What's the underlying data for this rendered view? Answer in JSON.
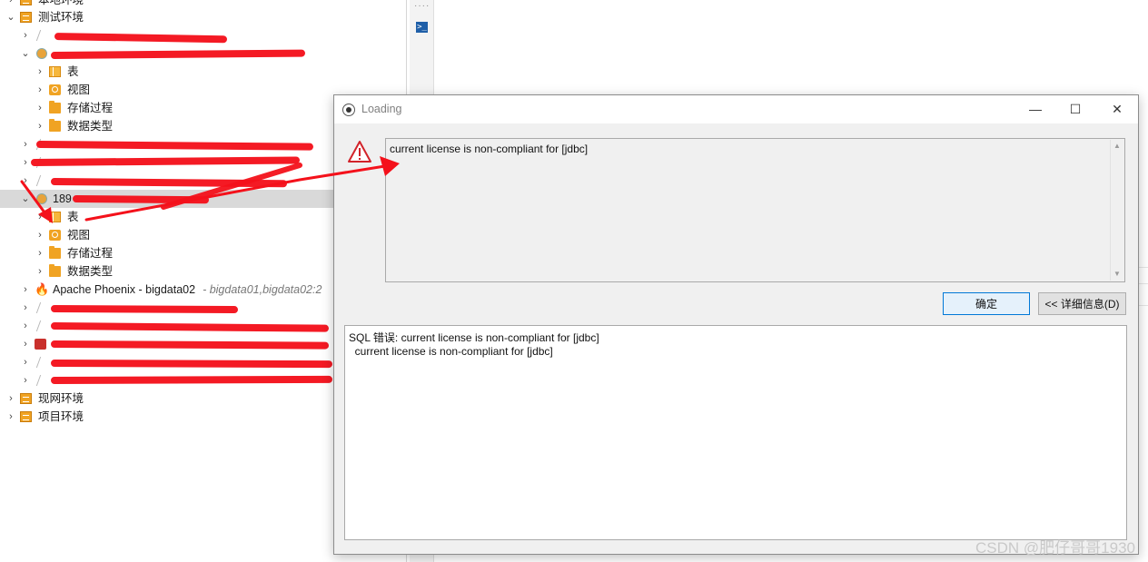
{
  "navigator": {
    "rows": [
      {
        "label": "本地环境",
        "sub": ""
      },
      {
        "label": "测试环境",
        "sub": ""
      },
      {
        "label": "",
        "sub": ""
      },
      {
        "label": "",
        "sub": ""
      },
      {
        "label": "表",
        "sub": ""
      },
      {
        "label": "视图",
        "sub": ""
      },
      {
        "label": "存储过程",
        "sub": ""
      },
      {
        "label": "数据类型",
        "sub": ""
      },
      {
        "label": "",
        "sub": ""
      },
      {
        "label": "",
        "sub": ""
      },
      {
        "label": "",
        "sub": ""
      },
      {
        "label": "189",
        "sub": ""
      },
      {
        "label": "表",
        "sub": ""
      },
      {
        "label": "视图",
        "sub": ""
      },
      {
        "label": "存储过程",
        "sub": ""
      },
      {
        "label": "数据类型",
        "sub": ""
      },
      {
        "label": "Apache Phoenix - bigdata02",
        "sub": "- bigdata01,bigdata02:2"
      },
      {
        "label": "",
        "sub": ""
      },
      {
        "label": "",
        "sub": ""
      },
      {
        "label": "",
        "sub": ""
      },
      {
        "label": "",
        "sub": ""
      },
      {
        "label": "",
        "sub": ""
      },
      {
        "label": "现网环境",
        "sub": ""
      },
      {
        "label": "项目环境",
        "sub": ""
      }
    ]
  },
  "dialog": {
    "title": "Loading",
    "message": "current license is non-compliant for [jdbc]",
    "ok_label": "确定",
    "details_label": "<< 详细信息(D)",
    "detail_lines": [
      "SQL 错误: current license is non-compliant for [jdbc]",
      "  current license is non-compliant for [jdbc]"
    ],
    "minimize_glyph": "—",
    "maximize_glyph": "☐",
    "close_glyph": "✕"
  },
  "watermark": "CSDN @肥仔哥哥1930",
  "colors": {
    "accent": "#0078d7",
    "folder": "#f0a323",
    "scribble": "#f4111b",
    "warning": "#d2232a"
  },
  "icons": {
    "terminal": "terminal-icon",
    "warning": "warning-triangle-icon"
  }
}
